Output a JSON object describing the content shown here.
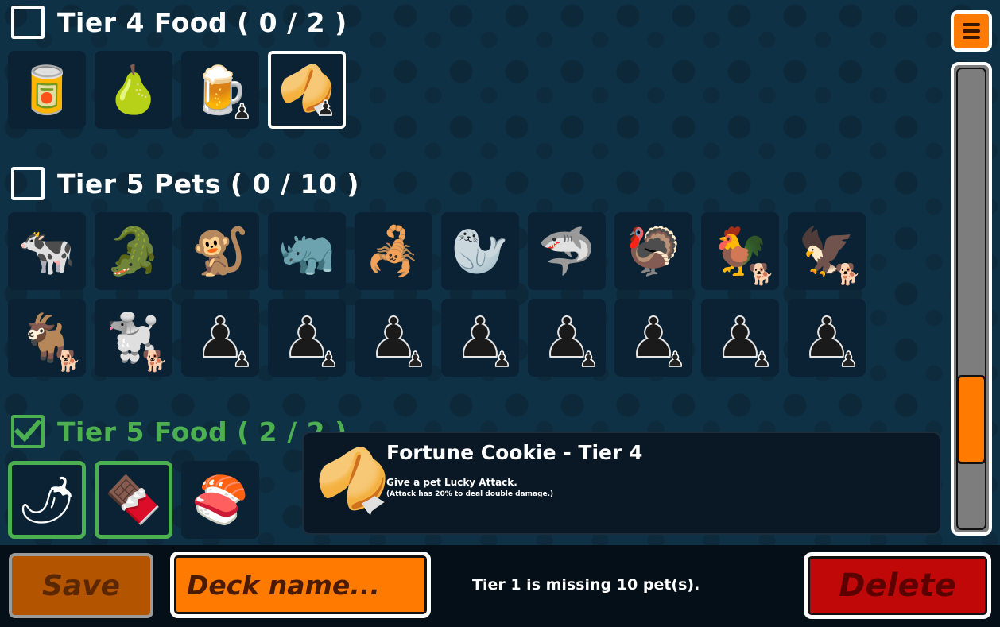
{
  "sections": [
    {
      "id": "tier4-food",
      "title": "Tier 4 Food ( 0 / 2 )",
      "checked": false
    },
    {
      "id": "tier5-pets",
      "title": "Tier 5 Pets ( 0 / 10 )",
      "checked": false
    },
    {
      "id": "tier5-food",
      "title": "Tier 5 Food ( 2 / 2 )",
      "checked": true
    }
  ],
  "tier4_food_items": [
    {
      "name": "canned-food",
      "glyph": "🥫",
      "badge": ""
    },
    {
      "name": "pear",
      "glyph": "🍐",
      "badge": ""
    },
    {
      "name": "beer",
      "glyph": "🍺",
      "badge": "pawn"
    },
    {
      "name": "fortune-cookie",
      "glyph": "🥠",
      "badge": "pawn",
      "selected": true
    }
  ],
  "tier5_pets_row1": [
    {
      "name": "cow",
      "glyph": "🐄",
      "badge": ""
    },
    {
      "name": "crocodile",
      "glyph": "🐊",
      "badge": ""
    },
    {
      "name": "monkey",
      "glyph": "🐒",
      "badge": ""
    },
    {
      "name": "rhino",
      "glyph": "🦏",
      "badge": ""
    },
    {
      "name": "scorpion",
      "glyph": "🦂",
      "badge": ""
    },
    {
      "name": "seal",
      "glyph": "🦭",
      "badge": ""
    },
    {
      "name": "shark",
      "glyph": "🦈",
      "badge": ""
    },
    {
      "name": "turkey",
      "glyph": "🦃",
      "badge": ""
    },
    {
      "name": "rooster",
      "glyph": "🐓",
      "badge": "puppy"
    },
    {
      "name": "eagle",
      "glyph": "🦅",
      "badge": "puppy"
    }
  ],
  "tier5_pets_row2": [
    {
      "name": "goat",
      "glyph": "🐐",
      "badge": "puppy"
    },
    {
      "name": "poodle",
      "glyph": "🐩",
      "badge": "puppy"
    },
    {
      "name": "locked-pet",
      "glyph": "♟",
      "badge": "pawn"
    },
    {
      "name": "locked-pet",
      "glyph": "♟",
      "badge": "pawn"
    },
    {
      "name": "locked-pet",
      "glyph": "♟",
      "badge": "pawn"
    },
    {
      "name": "locked-pet",
      "glyph": "♟",
      "badge": "pawn"
    },
    {
      "name": "locked-pet",
      "glyph": "♟",
      "badge": "pawn"
    },
    {
      "name": "locked-pet",
      "glyph": "♟",
      "badge": "pawn"
    },
    {
      "name": "locked-pet",
      "glyph": "♟",
      "badge": "pawn"
    },
    {
      "name": "locked-pet",
      "glyph": "♟",
      "badge": "pawn"
    }
  ],
  "tier5_food_items": [
    {
      "name": "chili",
      "glyph": "🌶",
      "badge": "",
      "owned": true
    },
    {
      "name": "chocolate",
      "glyph": "🍫",
      "badge": "",
      "owned": true
    },
    {
      "name": "sushi",
      "glyph": "🍣",
      "badge": ""
    }
  ],
  "tooltip": {
    "icon": "🥠",
    "title": "Fortune Cookie - Tier 4",
    "description": "Give a pet Lucky Attack.",
    "note": "(Attack has 20% to deal double damage.)"
  },
  "bottom": {
    "save_label": "Save",
    "deck_placeholder": "Deck name...",
    "status": "Tier 1 is missing 10 pet(s).",
    "delete_label": "Delete"
  },
  "scrollbar": {
    "position": 0.69
  },
  "colors": {
    "accent": "#ff7a00",
    "complete": "#4caf50",
    "danger": "#c00808",
    "background": "#0f3146"
  }
}
